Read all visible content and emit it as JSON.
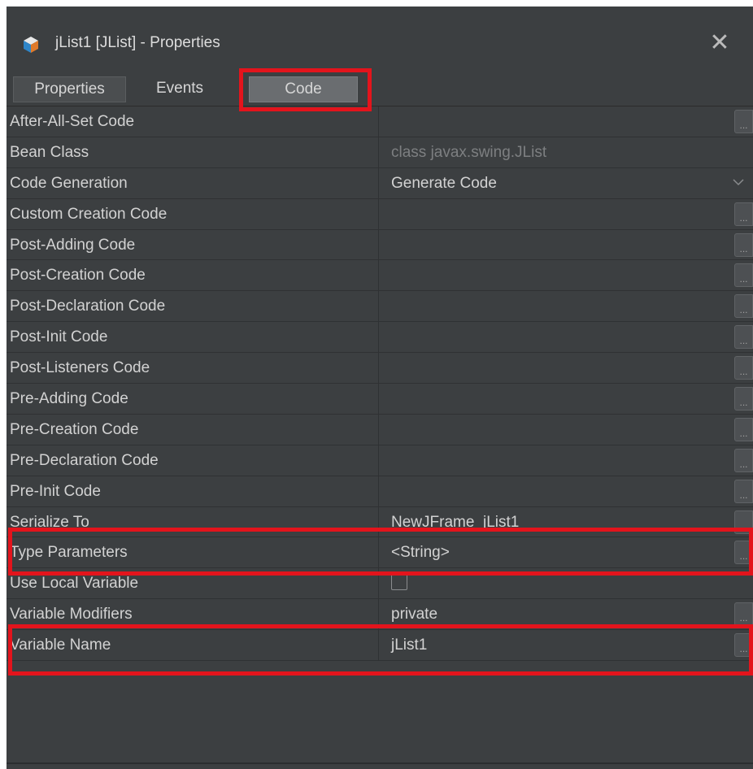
{
  "window": {
    "title": "jList1 [JList] - Properties",
    "close_symbol": "✕",
    "icon": "netbeans-cube-icon"
  },
  "tabs": [
    {
      "label": "Properties",
      "state": "normal"
    },
    {
      "label": "Events",
      "state": "normal"
    },
    {
      "label": "Code",
      "state": "selected"
    }
  ],
  "properties": [
    {
      "name": "After-All-Set Code",
      "value": "",
      "editor": "ellipsis"
    },
    {
      "name": "Bean Class",
      "value": "class javax.swing.JList",
      "editor": "none",
      "disabled": true
    },
    {
      "name": "Code Generation",
      "value": "Generate Code",
      "editor": "dropdown"
    },
    {
      "name": "Custom Creation Code",
      "value": "",
      "editor": "ellipsis"
    },
    {
      "name": "Post-Adding Code",
      "value": "",
      "editor": "ellipsis"
    },
    {
      "name": "Post-Creation Code",
      "value": "",
      "editor": "ellipsis"
    },
    {
      "name": "Post-Declaration Code",
      "value": "",
      "editor": "ellipsis"
    },
    {
      "name": "Post-Init Code",
      "value": "",
      "editor": "ellipsis"
    },
    {
      "name": "Post-Listeners Code",
      "value": "",
      "editor": "ellipsis"
    },
    {
      "name": "Pre-Adding Code",
      "value": "",
      "editor": "ellipsis"
    },
    {
      "name": "Pre-Creation Code",
      "value": "",
      "editor": "ellipsis"
    },
    {
      "name": "Pre-Declaration Code",
      "value": "",
      "editor": "ellipsis"
    },
    {
      "name": "Pre-Init Code",
      "value": "",
      "editor": "ellipsis"
    },
    {
      "name": "Serialize To",
      "value": "NewJFrame_jList1",
      "editor": "ellipsis"
    },
    {
      "name": "Type Parameters",
      "value": "<String>",
      "editor": "ellipsis"
    },
    {
      "name": "Use Local Variable",
      "value": "",
      "editor": "checkbox",
      "checked": false
    },
    {
      "name": "Variable Modifiers",
      "value": "private",
      "editor": "ellipsis"
    },
    {
      "name": "Variable Name",
      "value": "jList1",
      "editor": "ellipsis"
    }
  ],
  "ellipsis_label": "...",
  "colors": {
    "highlight": "#e3141c",
    "background": "#3c3f41"
  }
}
